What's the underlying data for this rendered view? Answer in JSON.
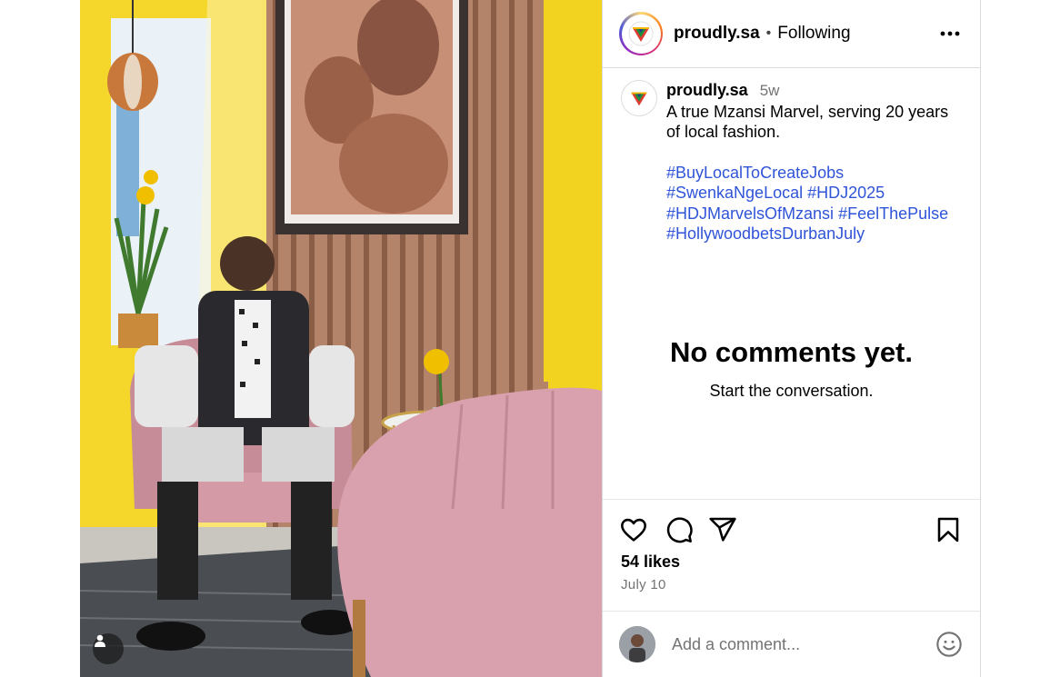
{
  "post": {
    "username": "proudly.sa",
    "follow_status": "Following",
    "separator": "•"
  },
  "caption": {
    "username": "proudly.sa",
    "time_ago": "5w",
    "text": "A true Mzansi Marvel, serving 20 years of local fashion.",
    "hashtags": [
      "#BuyLocalToCreateJobs",
      "#SwenkaNgeLocal",
      "#HDJ2025",
      "#HDJMarvelsOfMzansi",
      "#FeelThePulse",
      "#HollywoodbetsDurbanJuly"
    ]
  },
  "comments": {
    "empty_title": "No comments yet.",
    "empty_subtitle": "Start the conversation."
  },
  "engagement": {
    "likes": "54 likes",
    "date": "July 10"
  },
  "comment_box": {
    "placeholder": "Add a comment..."
  },
  "icons": {
    "more": "more-horizontal-icon",
    "like": "heart-icon",
    "comment": "comment-bubble-icon",
    "share": "paper-plane-icon",
    "save": "bookmark-icon",
    "emoji": "smiley-icon",
    "user_tag": "user-silhouette-icon"
  },
  "colors": {
    "hashtag": "#2f54d8",
    "secondary_text": "#737373",
    "border": "#dbdbdb",
    "wall_yellow": "#f2d31f",
    "chair_pink": "#d9a1ad"
  }
}
